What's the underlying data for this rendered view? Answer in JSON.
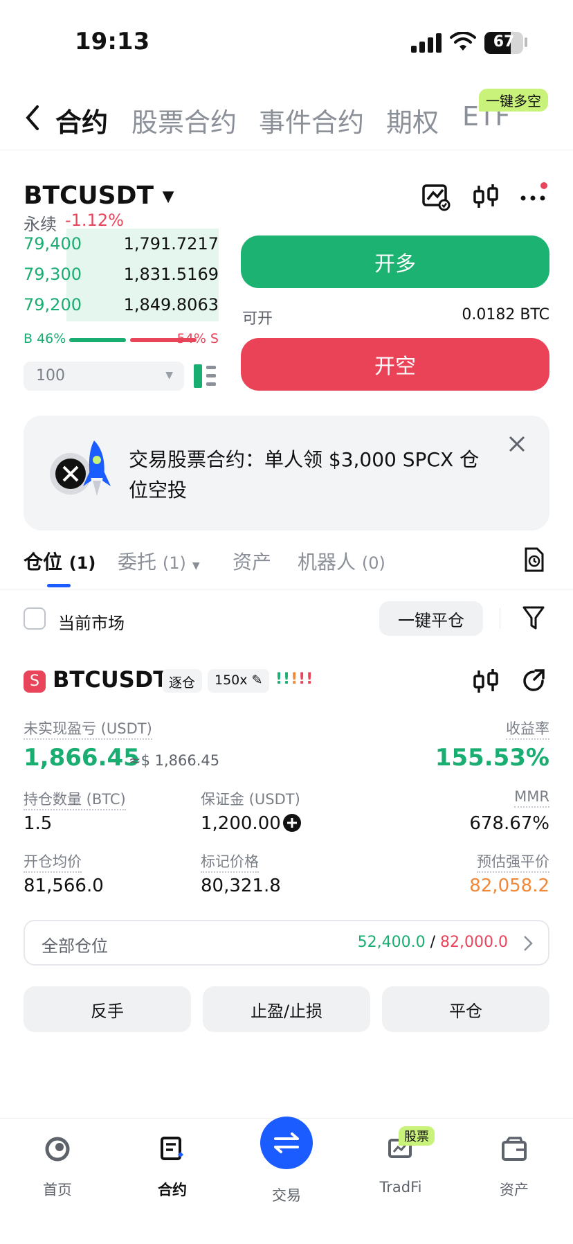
{
  "status": {
    "time": "19:13",
    "battery": "67",
    "battery_level": 0.67
  },
  "top_tabs": [
    "合约",
    "股票合约",
    "事件合约",
    "期权",
    "ETF"
  ],
  "top_badge": "一键多空",
  "symbol": {
    "name": "BTCUSDT",
    "type": "永续",
    "change": "-1.12%"
  },
  "orderbook": [
    {
      "price": "79,400",
      "amount": "1,791.7217",
      "depth": 0.72
    },
    {
      "price": "79,300",
      "amount": "1,831.5169",
      "depth": 0.76
    },
    {
      "price": "79,200",
      "amount": "1,849.8063",
      "depth": 0.78
    }
  ],
  "ratio": {
    "buy": "B 46%",
    "sell": "54% S",
    "buy_fraction": 0.46
  },
  "qty_select": "100",
  "buttons": {
    "long": "开多",
    "short": "开空"
  },
  "available": {
    "label": "可开",
    "value": "0.0182 BTC"
  },
  "promo": {
    "text": "交易股票合约：单人领 $3,000 SPCX 仓位空投"
  },
  "pos_tabs": [
    {
      "label": "仓位",
      "count": "(1)"
    },
    {
      "label": "委托",
      "count": "(1)"
    },
    {
      "label": "资产",
      "count": ""
    },
    {
      "label": "机器人",
      "count": "(0)"
    }
  ],
  "filter": {
    "current_market": "当前市场",
    "close_all": "一键平仓"
  },
  "position": {
    "badge": "S",
    "symbol": "BTCUSDT",
    "margin_mode": "逐仓",
    "leverage": "150x",
    "pnl_label": "未实现盈亏 (USDT)",
    "pnl": "1,866.45",
    "pnl_usd": "≈$ 1,866.45",
    "roe_label": "收益率",
    "roe": "155.53%",
    "size_label": "持仓数量 (BTC)",
    "size": "1.5",
    "margin_label": "保证金 (USDT)",
    "margin": "1,200.00",
    "mmr_label": "MMR",
    "mmr": "678.67%",
    "entry_label": "开仓均价",
    "entry": "81,566.0",
    "mark_label": "标记价格",
    "mark": "80,321.8",
    "liq_label": "预估强平价",
    "liq": "82,058.2"
  },
  "all_positions": {
    "label": "全部仓位",
    "long": "52,400.0",
    "sep": "/",
    "short": "82,000.0"
  },
  "actions": [
    "反手",
    "止盈/止损",
    "平仓"
  ],
  "bottom_nav": [
    "首页",
    "合约",
    "交易",
    "TradFi",
    "资产"
  ],
  "nav_badge": "股票",
  "colors": {
    "green": "#1aad72",
    "red": "#e8445a",
    "blue": "#1a5cff",
    "orange": "#f0883a"
  }
}
